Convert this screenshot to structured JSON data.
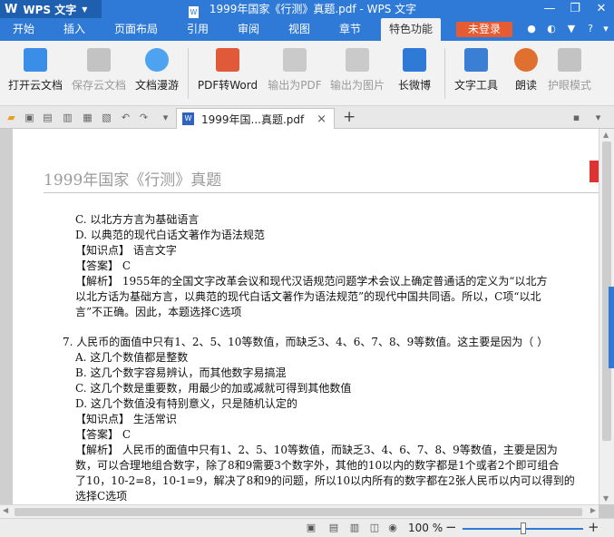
{
  "app": {
    "name": "WPS 文字",
    "window_title": "1999年国家《行测》真题.pdf - WPS 文字"
  },
  "menu": {
    "tabs": [
      "开始",
      "插入",
      "页面布局",
      "引用",
      "审阅",
      "视图",
      "章节",
      "特色功能"
    ],
    "active": "特色功能",
    "login": "未登录",
    "help": "?"
  },
  "ribbon": {
    "open_cloud": "打开云文档",
    "save_cloud": "保存云文档",
    "doc_roam": "文档漫游",
    "pdf_to_word": "PDF转Word",
    "export_pdf": "输出为PDF",
    "export_img": "输出为图片",
    "weibo": "长微博",
    "text_tools": "文字工具",
    "read_aloud": "朗读",
    "eye_mode": "护眼模式"
  },
  "tab": {
    "label": "1999年国...真题.pdf",
    "close": "×",
    "add": "+"
  },
  "document": {
    "header": "1999年国家《行测》真题",
    "lines": [
      "C. 以北方方言为基础语言",
      "D. 以典范的现代白话文著作为语法规范",
      "【知识点】 语言文字",
      "【答案】 C",
      "【解析】 1955年的全国文字改革会议和现代汉语规范问题学术会议上确定普通话的定义为“以北方",
      "以北方话为基础方言，以典范的现代白话文著作为语法规范”的现代中国共同语。所以，C项“以北",
      "言”不正确。因此，本题选择C选项",
      "7. 人民币的面值中只有1、2、5、10等数值，而缺乏3、4、6、7、8、9等数值。这主要是因为（        ）",
      "A. 这几个数值都是整数",
      "B. 这几个数字容易辨认，而其他数字易搞混",
      "C. 这几个数是重要数，用最少的加或减就可得到其他数值",
      "D. 这几个数值没有特别意义，只是随机认定的",
      "【知识点】 生活常识",
      "【答案】 C",
      "【解析】 人民币的面值中只有1、2、5、10等数值，而缺乏3、4、6、7、8、9等数值，主要是因为",
      "数，可以合理地组合数字，除了8和9需要3个数字外，其他的10以内的数字都是1个或者2个即可组合",
      "了10，10-2=8，10-1=9，解决了8和9的问题，所以10以内所有的数字都在2张人民币以内可以得到的",
      "选择C选项"
    ]
  },
  "status": {
    "zoom": "100 %",
    "minus": "−",
    "plus": "+"
  }
}
